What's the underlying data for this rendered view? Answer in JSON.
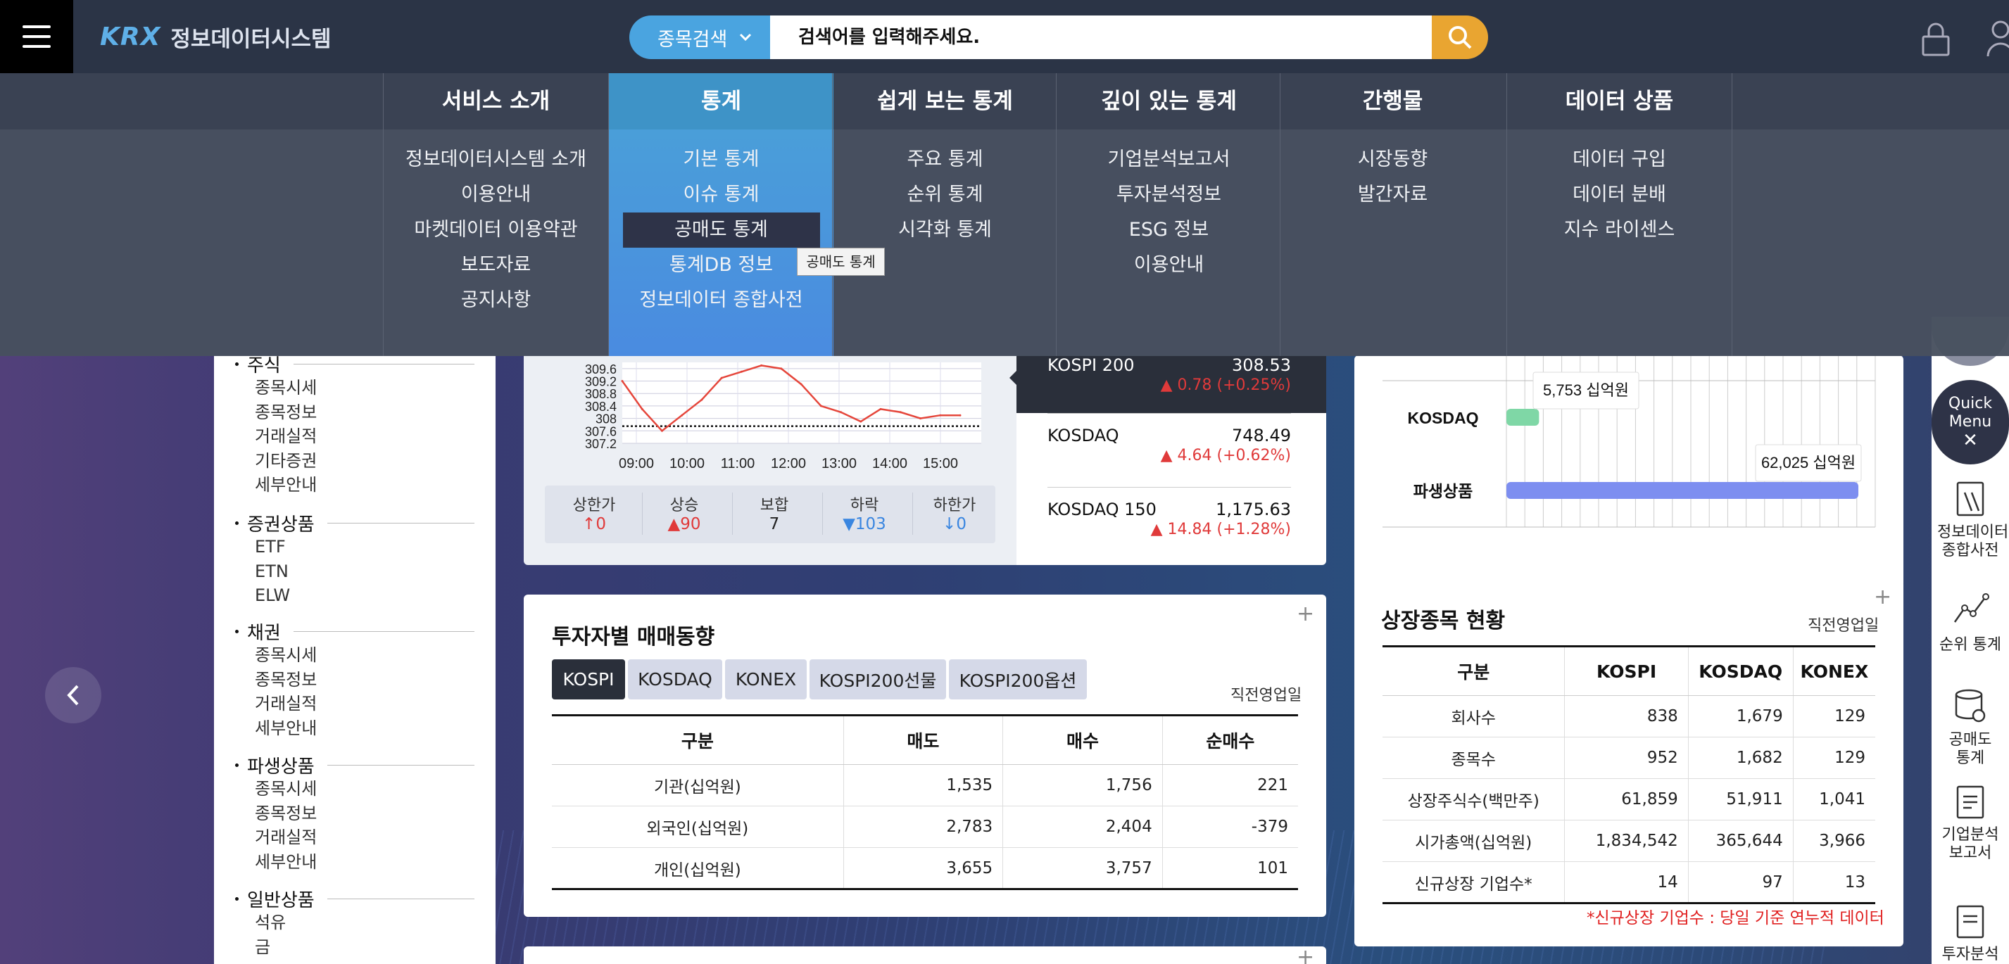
{
  "header": {
    "logo_mark": "KRX",
    "logo_text": "정보데이터시스템",
    "search_category": "종목검색",
    "search_placeholder": "검색어를 입력해주세요."
  },
  "menu": [
    {
      "title": "서비스 소개",
      "items": [
        "정보데이터시스템 소개",
        "이용안내",
        "마켓데이터 이용약관",
        "보도자료",
        "공지사항"
      ]
    },
    {
      "title": "통계",
      "items": [
        "기본 통계",
        "이슈 통계",
        "공매도 통계",
        "통계DB 정보",
        "정보데이터 종합사전"
      ]
    },
    {
      "title": "쉽게 보는 통계",
      "items": [
        "주요 통계",
        "순위 통계",
        "시각화 통계"
      ]
    },
    {
      "title": "깊이 있는 통계",
      "items": [
        "기업분석보고서",
        "투자분석정보",
        "ESG 정보",
        "이용안내"
      ]
    },
    {
      "title": "간행물",
      "items": [
        "시장동향",
        "발간자료"
      ]
    },
    {
      "title": "데이터 상품",
      "items": [
        "데이터 구입",
        "데이터 분배",
        "지수 라이센스"
      ]
    }
  ],
  "tooltip": "공매도 통계",
  "sidebar": {
    "groups": [
      {
        "title": "주식",
        "items": [
          "종목시세",
          "종목정보",
          "거래실적",
          "기타증권",
          "세부안내"
        ]
      },
      {
        "title": "증권상품",
        "items": [
          "ETF",
          "ETN",
          "ELW"
        ]
      },
      {
        "title": "채권",
        "items": [
          "종목시세",
          "종목정보",
          "거래실적",
          "세부안내"
        ]
      },
      {
        "title": "파생상품",
        "items": [
          "종목시세",
          "종목정보",
          "거래실적",
          "세부안내"
        ]
      },
      {
        "title": "일반상품",
        "items": [
          "석유",
          "금"
        ]
      }
    ]
  },
  "chart_data": {
    "type": "line",
    "x_ticks": [
      "09:00",
      "10:00",
      "11:00",
      "12:00",
      "13:00",
      "14:00",
      "15:00"
    ],
    "y_ticks": [
      "309.6",
      "309.2",
      "308.8",
      "308.4",
      "308",
      "307.6",
      "307.2"
    ],
    "ylim": [
      307.2,
      309.8
    ],
    "reference": 307.75,
    "series": [
      {
        "values": [
          309.2,
          308.3,
          307.6,
          308.1,
          308.6,
          309.3,
          309.5,
          309.7,
          309.6,
          309.1,
          308.4,
          308.2,
          307.9,
          308.3,
          308.2,
          308.0,
          308.1,
          308.1
        ]
      }
    ]
  },
  "market_stats": [
    {
      "label": "상한가",
      "arrow": "↑",
      "value": "0",
      "tone": "up"
    },
    {
      "label": "상승",
      "arrow": "▲",
      "value": "90",
      "tone": "up"
    },
    {
      "label": "보합",
      "arrow": "",
      "value": "7",
      "tone": "flat"
    },
    {
      "label": "하락",
      "arrow": "▼",
      "value": "103",
      "tone": "dn"
    },
    {
      "label": "하한가",
      "arrow": "↓",
      "value": "0",
      "tone": "dn"
    }
  ],
  "indices": [
    {
      "name": "KOSPI 200",
      "value": "308.53",
      "change": "▲ 0.78 (+0.25%)"
    },
    {
      "name": "KOSDAQ",
      "value": "748.49",
      "change": "▲ 4.64 (+0.62%)"
    },
    {
      "name": "KOSDAQ 150",
      "value": "1,175.63",
      "change": "▲ 14.84 (+1.28%)"
    }
  ],
  "trade_bars": [
    {
      "label": "KOSDAQ",
      "value": 5753,
      "tag": "5,753 십억원",
      "color": "#7fd7a6"
    },
    {
      "label": "파생상품",
      "value": 62025,
      "tag": "62,025 십억원",
      "color": "#7d8ef0"
    }
  ],
  "investor": {
    "title": "투자자별 매매동향",
    "tabs": [
      "KOSPI",
      "KOSDAQ",
      "KONEX",
      "KOSPI200선물",
      "KOSPI200옵션"
    ],
    "date_label": "직전영업일",
    "headers": [
      "구분",
      "매도",
      "매수",
      "순매수"
    ],
    "rows": [
      [
        "기관(십억원)",
        "1,535",
        "1,756",
        "221"
      ],
      [
        "외국인(십억원)",
        "2,783",
        "2,404",
        "-379"
      ],
      [
        "개인(십억원)",
        "3,655",
        "3,757",
        "101"
      ]
    ]
  },
  "listing": {
    "title": "상장종목 현황",
    "date_label": "직전영업일",
    "headers": [
      "구분",
      "KOSPI",
      "KOSDAQ",
      "KONEX"
    ],
    "rows": [
      [
        "회사수",
        "838",
        "1,679",
        "129"
      ],
      [
        "종목수",
        "952",
        "1,682",
        "129"
      ],
      [
        "상장주식수(백만주)",
        "61,859",
        "51,911",
        "1,041"
      ],
      [
        "시가총액(십억원)",
        "1,834,542",
        "365,644",
        "3,966"
      ],
      [
        "신규상장 기업수*",
        "14",
        "97",
        "13"
      ]
    ],
    "note": "*신규상장 기업수 : 당일 기준 연누적 데이터"
  },
  "quick_menu": {
    "label": "Quick Menu",
    "items": [
      "정보데이터 종합사전",
      "순위 통계",
      "공매도 통계",
      "기업분석 보고서",
      "투자분석"
    ]
  }
}
